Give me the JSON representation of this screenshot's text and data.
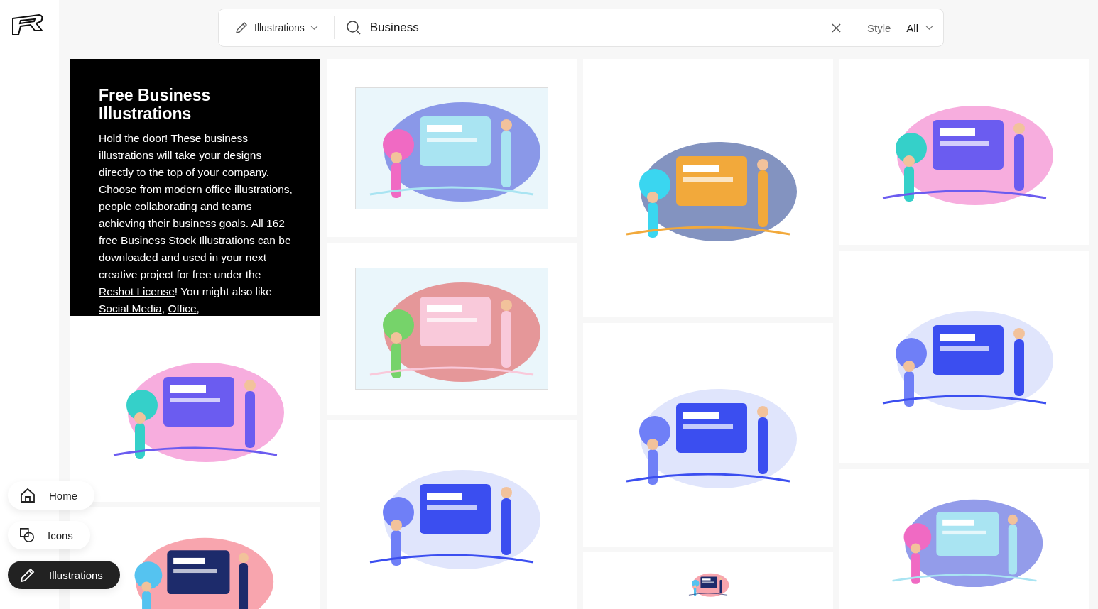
{
  "search_bar": {
    "category": "Illustrations",
    "query": "Business",
    "style_label": "Style",
    "style_value": "All"
  },
  "intro": {
    "title": "Free Business Illustrations",
    "paragraph": [
      {
        "text": "Hold the door! These business illustrations will take your designs directly to the top of your company. Choose from modern office illustrations, people collaborating and teams achieving their business goals. All 162 free Business Stock Illustrations can be downloaded and used in your next creative project for free under the ",
        "link": false
      },
      {
        "text": "Reshot License",
        "link": true
      },
      {
        "text": "! You might also like ",
        "link": false
      },
      {
        "text": "Social Media",
        "link": true
      },
      {
        "text": ", ",
        "link": false
      },
      {
        "text": "Office",
        "link": true
      },
      {
        "text": ",",
        "link": false
      }
    ]
  },
  "nav": [
    {
      "label": "Home",
      "selected": false
    },
    {
      "label": "Icons",
      "selected": false
    },
    {
      "label": "Illustrations",
      "selected": true
    }
  ]
}
